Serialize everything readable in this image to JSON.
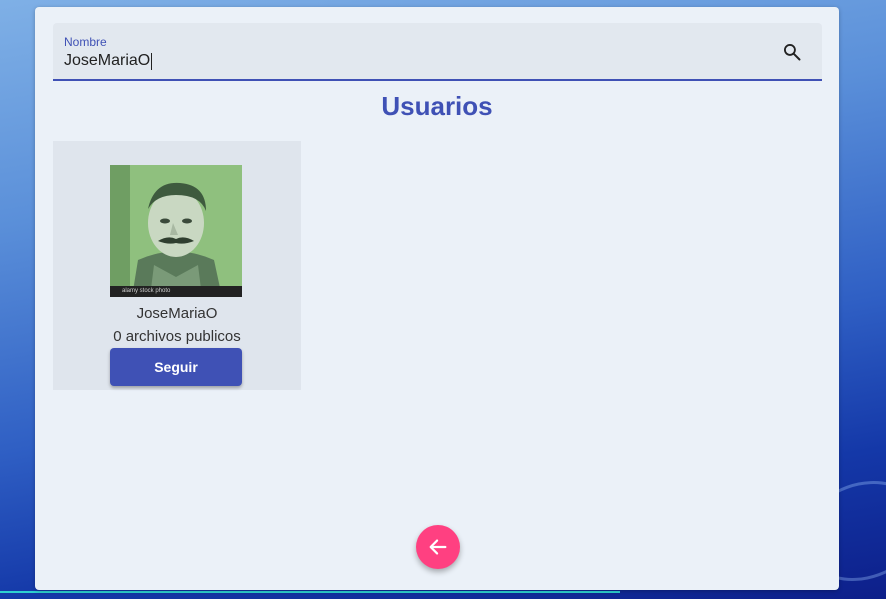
{
  "search": {
    "label": "Nombre",
    "value": "JoseMariaO",
    "icon": "search-icon"
  },
  "page": {
    "title": "Usuarios"
  },
  "users": [
    {
      "name": "JoseMariaO",
      "files_text": "0 archivos publicos",
      "follow_label": "Seguir",
      "avatar_caption": "alamy stock photo"
    }
  ],
  "fab": {
    "icon": "arrow-left-icon"
  },
  "colors": {
    "primary": "#3f51b5",
    "accent": "#ff4081",
    "panel": "#ebf1f8",
    "card": "#dfe5ed"
  }
}
